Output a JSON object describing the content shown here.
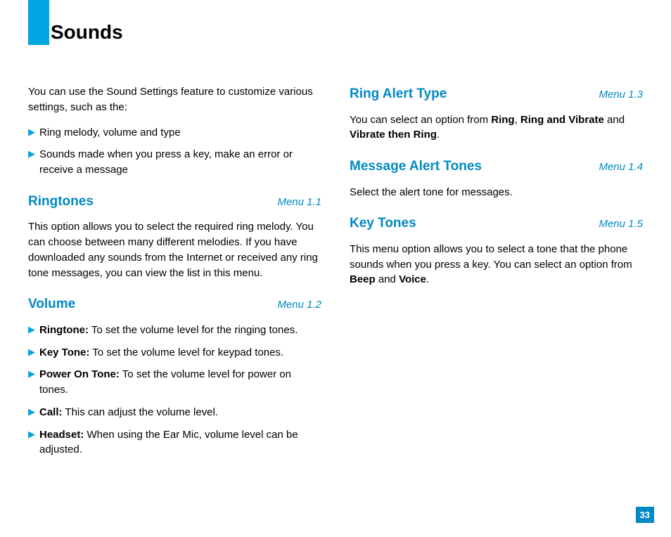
{
  "page_title": "Sounds",
  "page_number": "33",
  "left_column": {
    "intro": "You can use the Sound Settings feature to customize various settings, such as the:",
    "intro_bullets": [
      "Ring melody, volume and type",
      "Sounds made when you press a key, make an error or receive a message"
    ],
    "sections": [
      {
        "title": "Ringtones",
        "menu": "Menu 1.1",
        "body": "This option allows you to select the required ring melody. You can choose between many different melodies. If you have downloaded any sounds from the Internet or received any ring tone messages, you can view the list in this menu."
      },
      {
        "title": "Volume",
        "menu": "Menu 1.2",
        "bullets": [
          {
            "label": "Ringtone:",
            "text": " To set the volume level for the ringing tones."
          },
          {
            "label": "Key Tone:",
            "text": " To set the volume level for keypad tones."
          },
          {
            "label": "Power On Tone:",
            "text": " To set the volume level for power on tones."
          },
          {
            "label": "Call:",
            "text": " This can adjust the volume level."
          },
          {
            "label": "Headset:",
            "text": " When using the Ear Mic, volume level can be adjusted."
          }
        ]
      }
    ]
  },
  "right_column": {
    "sections": [
      {
        "title": "Ring Alert Type",
        "menu": "Menu 1.3",
        "body_parts": [
          "You can select an option from ",
          "Ring",
          ", ",
          "Ring and Vibrate",
          " and ",
          "Vibrate then Ring",
          "."
        ]
      },
      {
        "title": "Message Alert Tones",
        "menu": "Menu 1.4",
        "body": "Select the alert tone for messages."
      },
      {
        "title": "Key Tones",
        "menu": "Menu 1.5",
        "body_parts": [
          "This menu option allows you to select a tone that the phone sounds when you press a key. You can select an option from ",
          "Beep",
          " and ",
          "Voice",
          "."
        ]
      }
    ]
  }
}
